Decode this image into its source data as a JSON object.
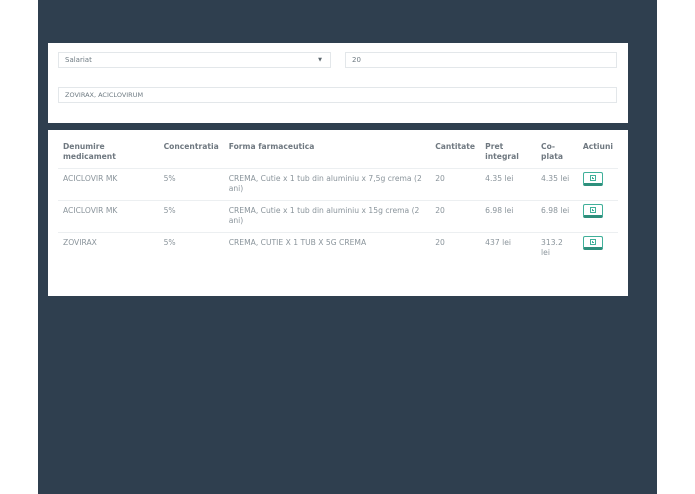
{
  "search": {
    "insurance_select": "Salariat",
    "quantity_value": "20",
    "medication_value": "ZOVIRAX, ACICLOVIRUM"
  },
  "table": {
    "headers": {
      "name": "Denumire medicament",
      "concentration": "Concentratia",
      "form": "Forma farmaceutica",
      "quantity": "Cantitate",
      "full_price": "Pret integral",
      "copay": "Co-plata",
      "actions": "Actiuni"
    },
    "rows": [
      {
        "name": "ACICLOVIR MK",
        "concentration": "5%",
        "form": "CREMA, Cutie x 1 tub din aluminiu x 7,5g crema (2 ani)",
        "quantity": "20",
        "full_price": "4.35 lei",
        "copay": "4.35 lei"
      },
      {
        "name": "ACICLOVIR MK",
        "concentration": "5%",
        "form": "CREMA, Cutie x 1 tub din aluminiu x 15g crema (2 ani)",
        "quantity": "20",
        "full_price": "6.98 lei",
        "copay": "6.98 lei"
      },
      {
        "name": "ZOVIRAX",
        "concentration": "5%",
        "form": "CREMA, CUTIE X 1 TUB X 5G CREMA",
        "quantity": "20",
        "full_price": "437 lei",
        "copay": "313.2 lei"
      }
    ]
  },
  "icons": {
    "select_caret": "caret-down-icon",
    "add": "plus-square-icon"
  },
  "colors": {
    "background": "#2f3f4f",
    "accent": "#40b09a"
  }
}
